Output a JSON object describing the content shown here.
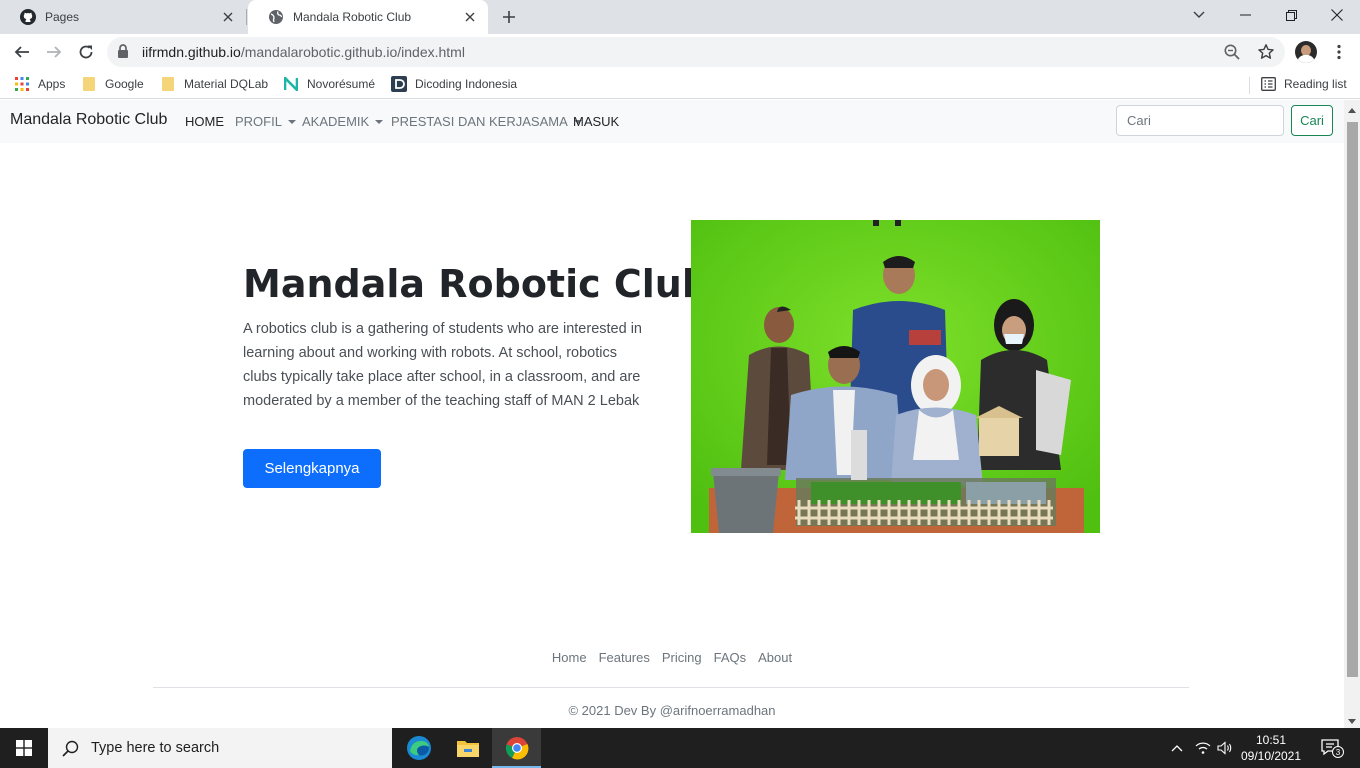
{
  "tabs": [
    {
      "title": "Pages",
      "active": false,
      "icon": "github-icon"
    },
    {
      "title": "Mandala Robotic Club",
      "active": true,
      "icon": "globe-icon"
    }
  ],
  "address": {
    "host": "iifrmdn.github.io",
    "path": "/mandalarobotic.github.io/index.html"
  },
  "bookmarks": [
    {
      "label": "Apps",
      "icon": "apps-grid-icon"
    },
    {
      "label": "Google",
      "icon": "folder-icon"
    },
    {
      "label": "Material DQLab",
      "icon": "folder-icon"
    },
    {
      "label": "Novorésumé",
      "icon": "novoresume-icon"
    },
    {
      "label": "Dicoding Indonesia",
      "icon": "dicoding-icon"
    }
  ],
  "reading_list": "Reading list",
  "site": {
    "brand": "Mandala Robotic Club",
    "nav": {
      "home": "HOME",
      "profil": "PROFIL",
      "akademik": "AKADEMIK",
      "prestasi": "PRESTASI DAN KERJASAMA",
      "masuk": "MASUK"
    },
    "search_placeholder": "Cari",
    "search_button": "Cari",
    "hero": {
      "title": "Mandala Robotic Club",
      "text": "A robotics club is a gathering of students who are interested in learning about and working with robots. At school, robotics clubs typically take place after school, in a classroom, and are moderated by a member of the teaching staff of MAN 2 Lebak",
      "button": "Selengkapnya"
    },
    "footer": {
      "links": [
        "Home",
        "Features",
        "Pricing",
        "FAQs",
        "About"
      ],
      "copyright": "© 2021 Dev By @arifnoerramadhan"
    }
  },
  "taskbar": {
    "search_placeholder": "Type here to search",
    "time": "10:51",
    "date": "09/10/2021",
    "notification_count": "3"
  },
  "colors": {
    "primary": "#0d6efd",
    "success": "#198754",
    "navbar_bg": "#f8f9fa",
    "green_screen": "#5fd11a"
  }
}
